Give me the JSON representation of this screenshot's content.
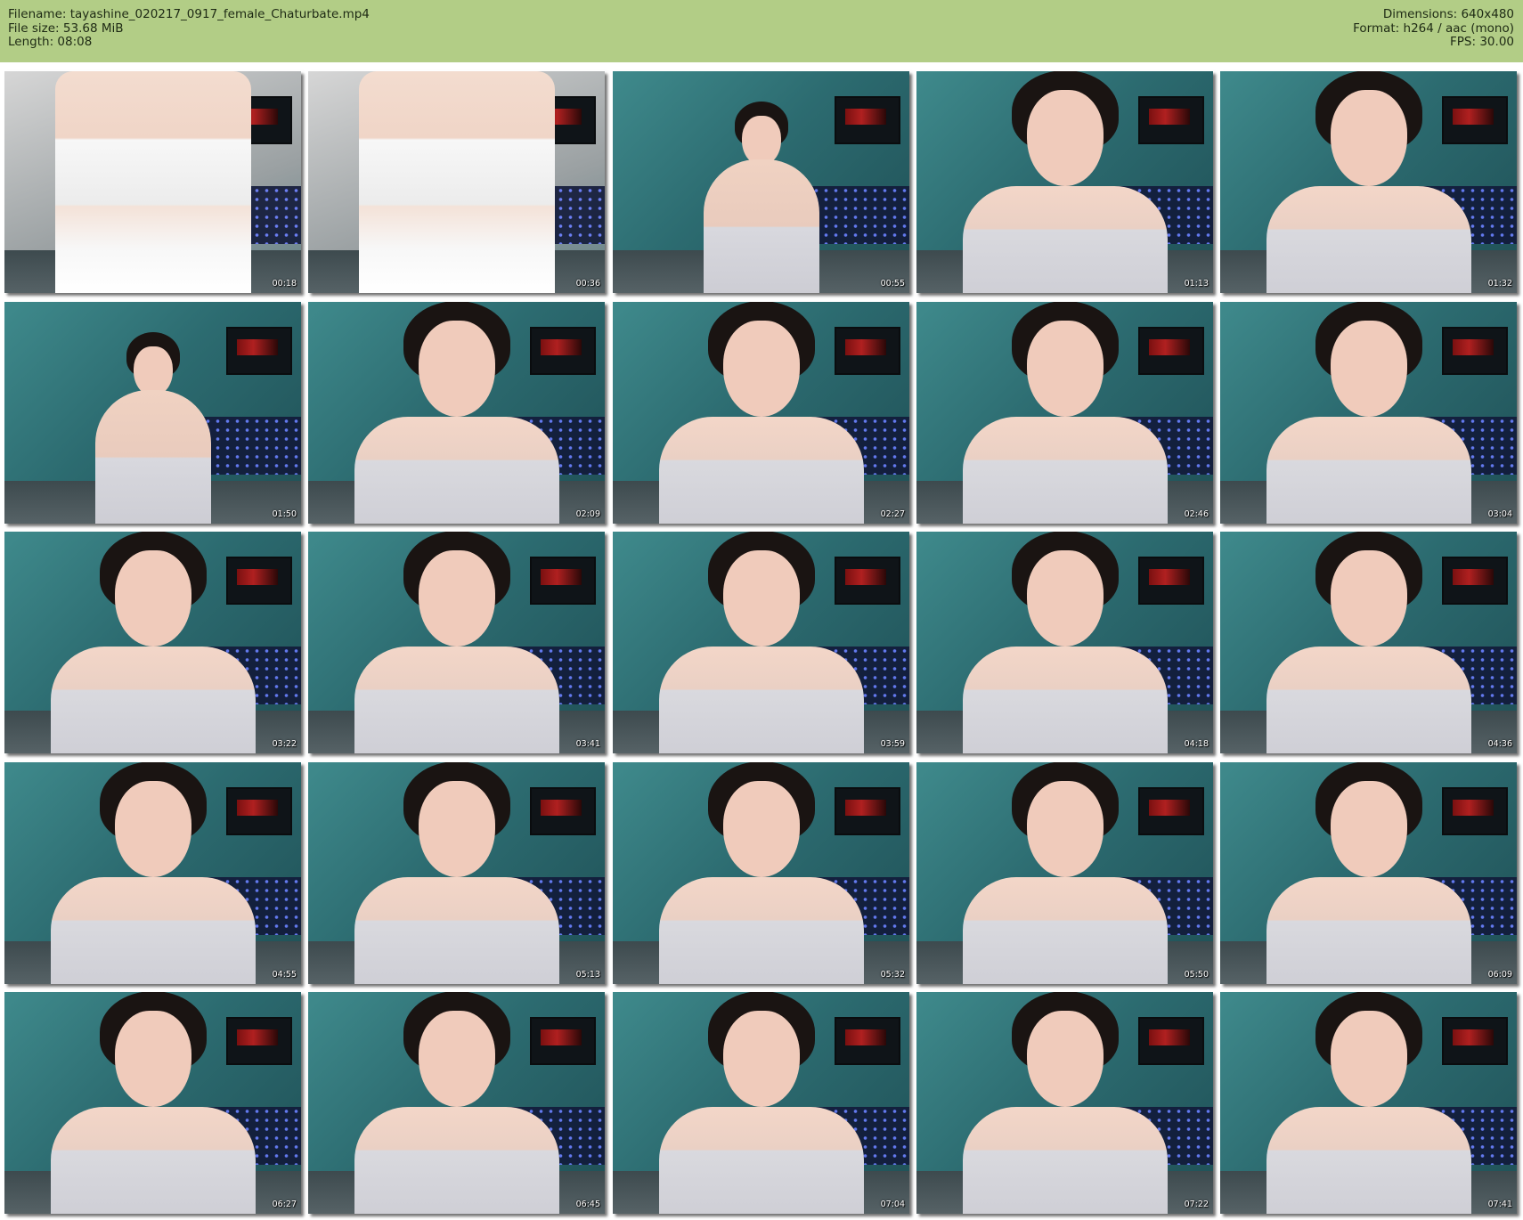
{
  "header": {
    "filename_label": "Filename:",
    "filename": "tayashine_020217_0917_female_Chaturbate.mp4",
    "filesize_label": "File size:",
    "filesize": "53.68 MiB",
    "length_label": "Length:",
    "length": "08:08",
    "dimensions_label": "Dimensions:",
    "dimensions": "640x480",
    "format_label": "Format:",
    "format": "h264 / aac (mono)",
    "fps_label": "FPS:",
    "fps": "30.00"
  },
  "colors": {
    "header_background": "#b2cd86",
    "page_background": "#ffffff",
    "timestamp_text": "#ffffff"
  },
  "thumbnails": [
    {
      "timestamp": "00:18",
      "variant": "lingerie"
    },
    {
      "timestamp": "00:36",
      "variant": "lingerie"
    },
    {
      "timestamp": "00:55",
      "variant": "wide"
    },
    {
      "timestamp": "01:13",
      "variant": "close"
    },
    {
      "timestamp": "01:32",
      "variant": "close"
    },
    {
      "timestamp": "01:50",
      "variant": "wide"
    },
    {
      "timestamp": "02:09",
      "variant": "close"
    },
    {
      "timestamp": "02:27",
      "variant": "close"
    },
    {
      "timestamp": "02:46",
      "variant": "close"
    },
    {
      "timestamp": "03:04",
      "variant": "close"
    },
    {
      "timestamp": "03:22",
      "variant": "close"
    },
    {
      "timestamp": "03:41",
      "variant": "close"
    },
    {
      "timestamp": "03:59",
      "variant": "close"
    },
    {
      "timestamp": "04:18",
      "variant": "close"
    },
    {
      "timestamp": "04:36",
      "variant": "close"
    },
    {
      "timestamp": "04:55",
      "variant": "close"
    },
    {
      "timestamp": "05:13",
      "variant": "close"
    },
    {
      "timestamp": "05:32",
      "variant": "close"
    },
    {
      "timestamp": "05:50",
      "variant": "close"
    },
    {
      "timestamp": "06:09",
      "variant": "close"
    },
    {
      "timestamp": "06:27",
      "variant": "close"
    },
    {
      "timestamp": "06:45",
      "variant": "close"
    },
    {
      "timestamp": "07:04",
      "variant": "close"
    },
    {
      "timestamp": "07:22",
      "variant": "close"
    },
    {
      "timestamp": "07:41",
      "variant": "close"
    }
  ]
}
